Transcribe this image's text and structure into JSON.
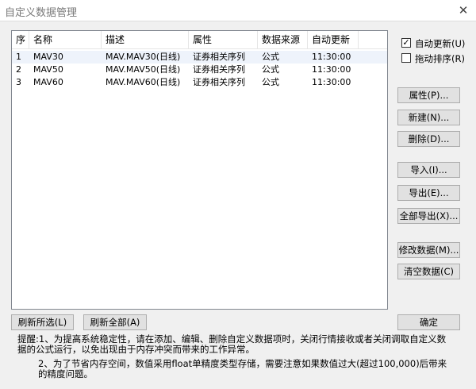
{
  "window": {
    "title": "自定义数据管理",
    "close_glyph": "✕"
  },
  "table": {
    "headers": [
      "序",
      "名称",
      "描述",
      "属性",
      "数据来源",
      "自动更新"
    ],
    "rows": [
      [
        "1",
        "MAV30",
        "MAV.MAV30(日线)",
        "证券相关序列",
        "公式",
        "11:30:00"
      ],
      [
        "2",
        "MAV50",
        "MAV.MAV50(日线)",
        "证券相关序列",
        "公式",
        "11:30:00"
      ],
      [
        "3",
        "MAV60",
        "MAV.MAV60(日线)",
        "证券相关序列",
        "公式",
        "11:30:00"
      ]
    ]
  },
  "options": {
    "auto_update": {
      "label": "自动更新(U)",
      "checked": true,
      "mark": "✓"
    },
    "drag_sort": {
      "label": "拖动排序(R)",
      "checked": false
    }
  },
  "buttons": {
    "properties": "属性(P)...",
    "new": "新建(N)...",
    "delete": "删除(D)...",
    "import": "导入(I)...",
    "export": "导出(E)...",
    "export_all": "全部导出(X)...",
    "modify_data": "修改数据(M)...",
    "clear_data": "清空数据(C)",
    "refresh_selected": "刷新所选(L)",
    "refresh_all": "刷新全部(A)",
    "ok": "确定"
  },
  "tips": {
    "line1": "提醒:1、为提高系统稳定性，请在添加、编辑、删除自定义数据项时，关闭行情接收或者关闭调取自定义数",
    "line2": "据的公式运行，以免出现由于内存冲突而带来的工作异常。",
    "line3": "2、为了节省内存空间，数值采用float单精度类型存储，需要注意如果数值过大(超过100,000)后带来",
    "line4": "的精度问题。"
  }
}
